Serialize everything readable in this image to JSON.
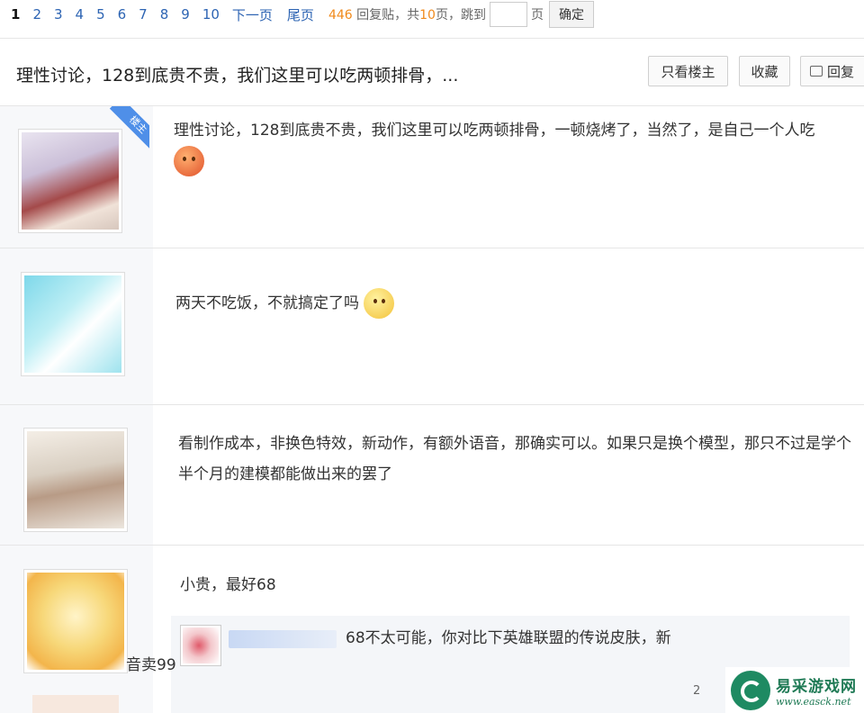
{
  "pagination": {
    "pages": [
      "1",
      "2",
      "3",
      "4",
      "5",
      "6",
      "7",
      "8",
      "9",
      "10"
    ],
    "current": "1",
    "next": "下一页",
    "last": "尾页",
    "reply_count": "446",
    "reply_label": "回复贴，共",
    "total_pages": "10",
    "pages_suffix": "页，跳到",
    "page_unit": "页",
    "confirm": "确定"
  },
  "thread": {
    "title": "理性讨论，128到底贵不贵，我们这里可以吃两顿排骨，...",
    "only_op": "只看楼主",
    "favorite": "收藏",
    "reply": "回复"
  },
  "posts": [
    {
      "badge": "楼主",
      "text": "理性讨论，128到底贵不贵，我们这里可以吃两顿排骨，一顿烧烤了，当然了，是自己一个人吃"
    },
    {
      "text": "两天不吃饭，不就搞定了吗"
    },
    {
      "text": "看制作成本，非换色特效，新动作，有额外语音，那确实可以。如果只是换个模型，那只不过是学个半个月的建模都能做出来的罢了"
    },
    {
      "text": "小贵，最好68"
    }
  ],
  "sub_reply": {
    "text": "68不太可能，你对比下英雄联盟的传说皮肤，新…音卖99",
    "line1": "68不太可能，你对比下英雄联盟的传说皮肤，新",
    "line2": "音卖99",
    "time": "2"
  },
  "watermark": {
    "name": "易采游戏网",
    "url": "www.easck.net"
  }
}
